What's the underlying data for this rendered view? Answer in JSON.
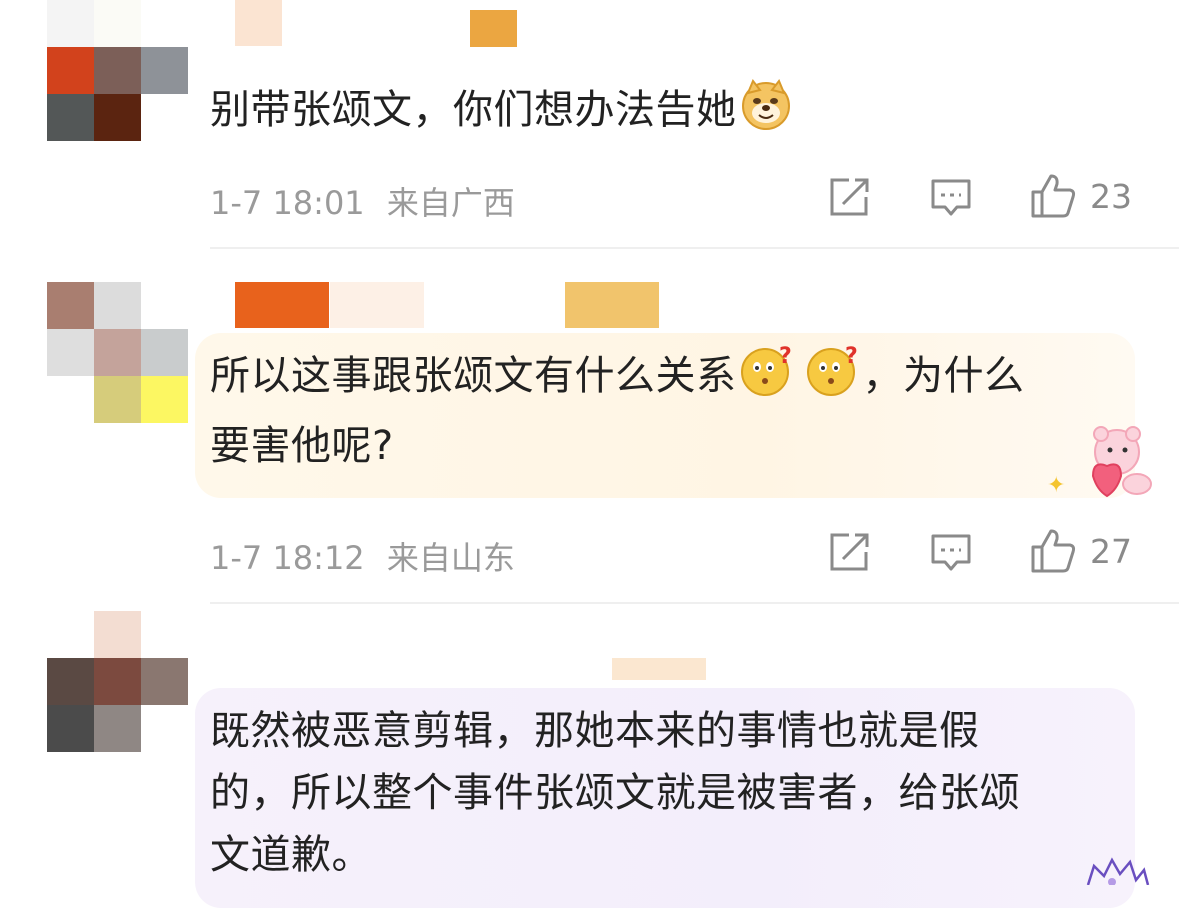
{
  "comments": [
    {
      "text": "别带张颂文，你们想办法告她",
      "time": "1-7 18:01",
      "location": "来自广西",
      "likes": "23",
      "emoji": "doge-emoji"
    },
    {
      "text_line1": "所以这事跟张颂文有什么关系",
      "text_after_emoji": "，为什么",
      "text_line2": "要害他呢?",
      "time": "1-7 18:12",
      "location": "来自山东",
      "likes": "27",
      "emoji": "confused-face-emoji"
    },
    {
      "text_line1": "既然被恶意剪辑，那她本来的事情也就是假",
      "text_line2": "的，所以整个事件张颂文就是被害者，给张颂",
      "text_line3": "文道歉。"
    }
  ],
  "icons": [
    "share-icon",
    "comment-icon",
    "like-icon"
  ],
  "colors": {
    "meta_text": "#9a9a9a",
    "divider": "#efefef",
    "bubble2": "#fff6e6",
    "bubble3": "#f4effb"
  }
}
